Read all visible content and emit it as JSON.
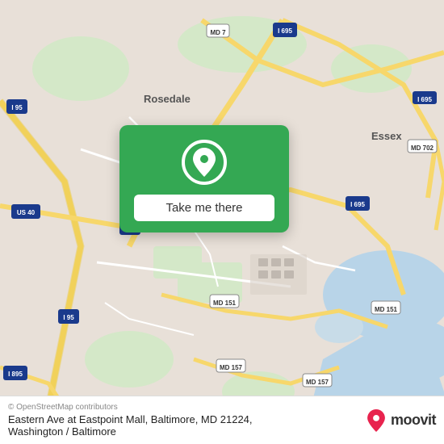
{
  "map": {
    "background_color": "#e8e0d8",
    "road_color_highway": "#f7d76b",
    "road_color_main": "#ffffff",
    "road_color_minor": "#f0ebe3",
    "water_color": "#b8d4e8"
  },
  "action_card": {
    "button_label": "Take me there",
    "background_color": "#34a853"
  },
  "bottom_bar": {
    "attribution": "© OpenStreetMap contributors",
    "location_text": "Eastern Ave at Eastpoint Mall, Baltimore, MD 21224,",
    "region_text": "Washington / Baltimore",
    "moovit_label": "moovit"
  }
}
